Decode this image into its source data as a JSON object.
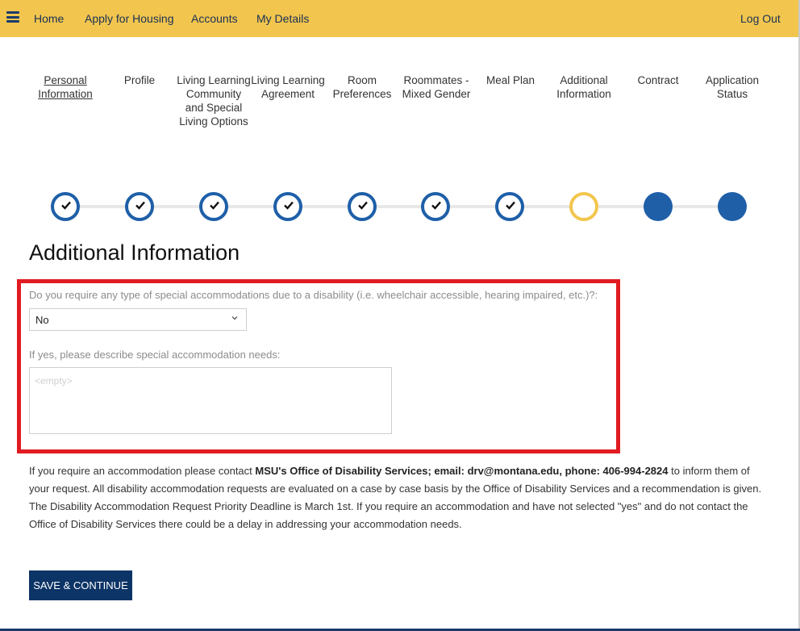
{
  "nav": {
    "items": [
      "Home",
      "Apply for Housing",
      "Accounts",
      "My Details"
    ],
    "logout": "Log Out"
  },
  "steps": [
    {
      "label": "Personal Information",
      "status": "done",
      "current": true
    },
    {
      "label": "Profile",
      "status": "done"
    },
    {
      "label": "Living Learning Community and Special Living Options",
      "status": "done"
    },
    {
      "label": "Living Learning Agreement",
      "status": "done"
    },
    {
      "label": "Room Preferences",
      "status": "done"
    },
    {
      "label": "Roommates - Mixed Gender",
      "status": "done"
    },
    {
      "label": "Meal Plan",
      "status": "done"
    },
    {
      "label": "Additional Information",
      "status": "active"
    },
    {
      "label": "Contract",
      "status": "todo"
    },
    {
      "label": "Application Status",
      "status": "todo"
    }
  ],
  "page": {
    "title": "Additional Information"
  },
  "form": {
    "accommodation_question": "Do you require any type of special accommodations due to a disability (i.e. wheelchair accessible, hearing impaired, etc.)?:",
    "accommodation_value": "No",
    "describe_label": "If yes, please describe special accommodation needs:",
    "describe_placeholder": "<empty>",
    "describe_value": ""
  },
  "info": {
    "intro": "If you require an accommodation please contact ",
    "contact": "MSU's Office of Disability Services; email: drv@montana.edu, phone: 406-994-2824",
    "rest": " to inform them of your request. All disability accommodation requests are evaluated on a case by case basis by the Office of Disability Services and a recommendation is given. The Disability Accommodation Request Priority Deadline is March 1st. If you require an accommodation and have not selected \"yes\" and do not contact the Office of Disability Services there could be a delay in addressing your accommodation needs."
  },
  "actions": {
    "save_label": "SAVE & CONTINUE"
  },
  "colors": {
    "topbar": "#f2c64e",
    "step_blue": "#1e5fa8",
    "step_active": "#f2c64e",
    "highlight": "#e11b22",
    "button": "#0d3466"
  },
  "icons": {
    "menu": "hamburger-icon",
    "step_done": "check-icon",
    "select": "chevron-down-icon"
  }
}
